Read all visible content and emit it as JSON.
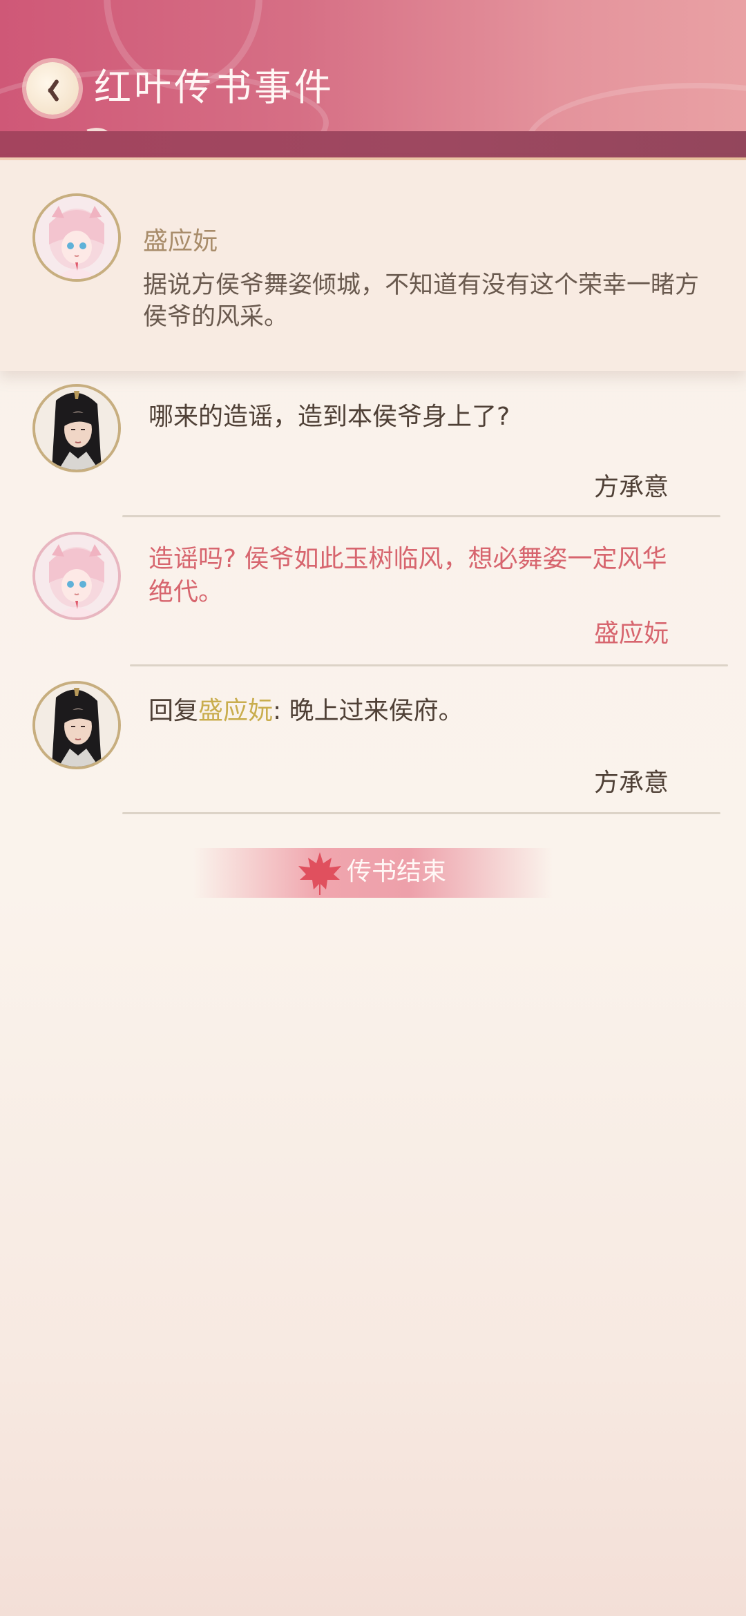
{
  "header": {
    "title": "红叶传书事件",
    "back_icon": "back-chevron-icon"
  },
  "colors": {
    "header_accent": "#cf5877",
    "header_band": "#a4445e",
    "name_gold": "#a88c6a",
    "reply_pink": "#d7656e",
    "mention_gold": "#c9ad4e",
    "text_dark": "#4f4036"
  },
  "post": {
    "author": "盛应妧",
    "text": "据说方侯爷舞姿倾城，不知道有没有这个荣幸一睹方侯爷的风采。"
  },
  "replies": [
    {
      "text": "哪来的造谣，造到本侯爷身上了?",
      "author": "方承意",
      "avatar": "male-avatar"
    },
    {
      "text": "造谣吗? 侯爷如此玉树临风，想必舞姿一定风华绝代。",
      "author": "盛应妧",
      "avatar": "female-avatar"
    },
    {
      "prefix": "回复",
      "mention": "盛应妧",
      "text": ": 晚上过来侯府。",
      "author": "方承意",
      "avatar": "male-avatar"
    }
  ],
  "end_banner": {
    "label": "传书结束",
    "icon": "maple-leaf-icon"
  }
}
